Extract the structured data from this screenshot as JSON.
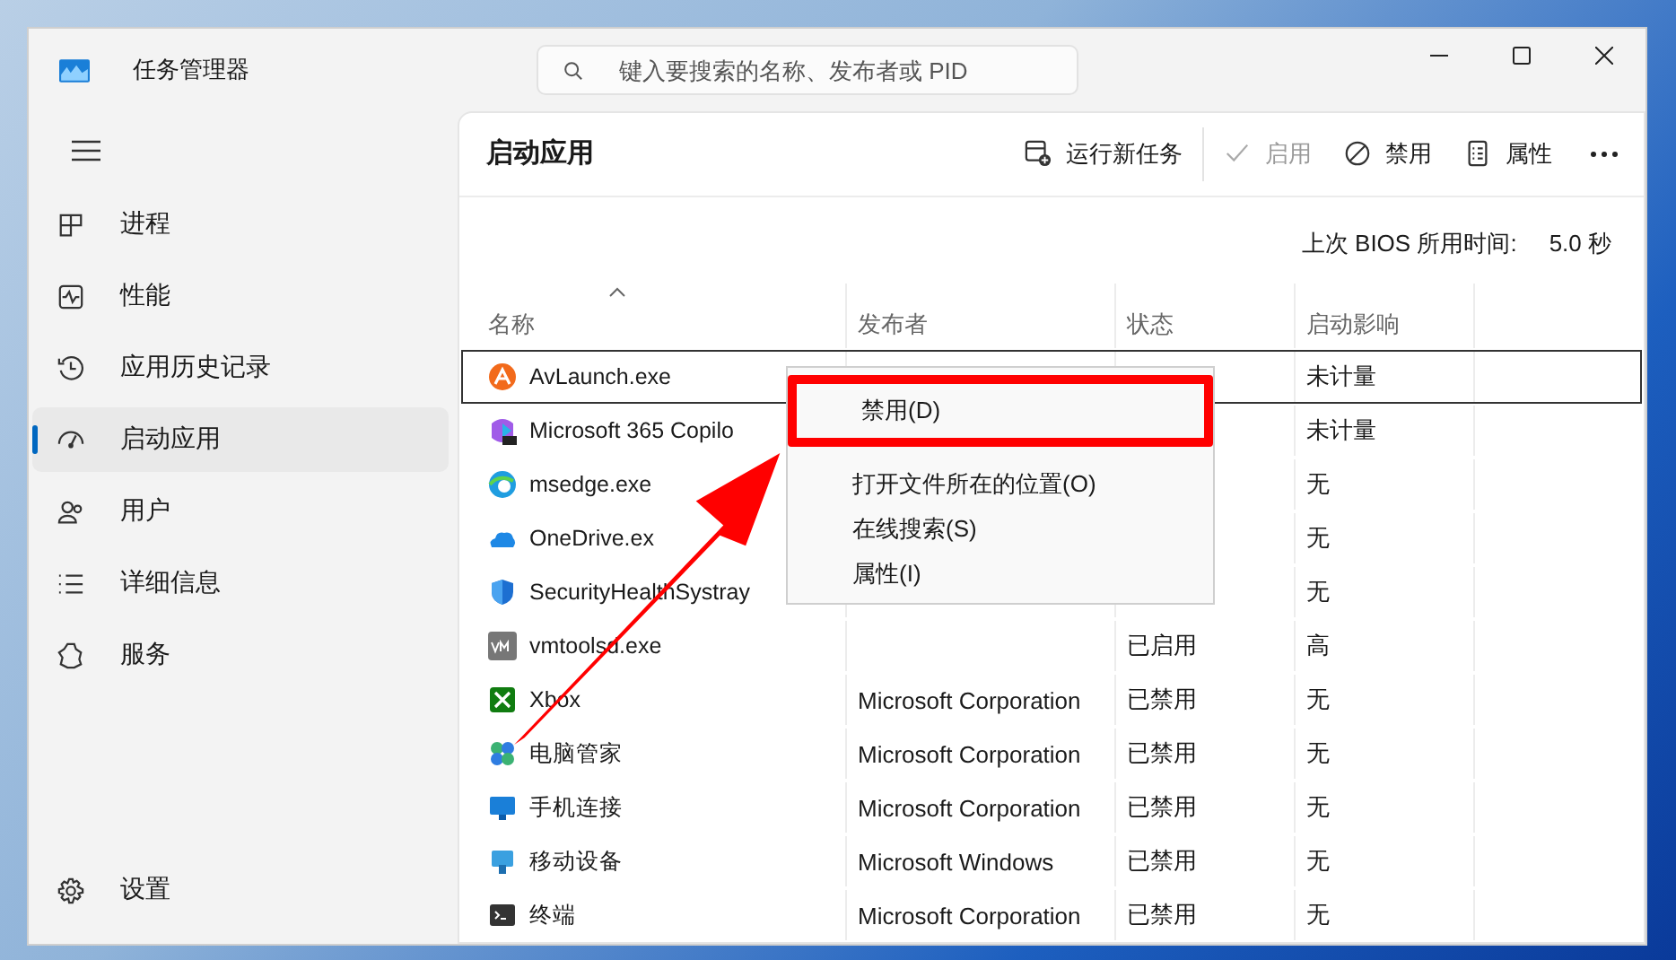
{
  "window": {
    "title": "任务管理器"
  },
  "search": {
    "placeholder": "键入要搜索的名称、发布者或 PID"
  },
  "sidebar": {
    "items": [
      {
        "label": "进程",
        "selected": false
      },
      {
        "label": "性能",
        "selected": false
      },
      {
        "label": "应用历史记录",
        "selected": false
      },
      {
        "label": "启动应用",
        "selected": true
      },
      {
        "label": "用户",
        "selected": false
      },
      {
        "label": "详细信息",
        "selected": false
      },
      {
        "label": "服务",
        "selected": false
      }
    ],
    "footer": {
      "label": "设置"
    }
  },
  "page": {
    "title": "启动应用",
    "toolbar": [
      {
        "label": "运行新任务",
        "disabled": false
      },
      {
        "label": "启用",
        "disabled": true
      },
      {
        "label": "禁用",
        "disabled": false
      },
      {
        "label": "属性",
        "disabled": false
      }
    ],
    "bios": {
      "label": "上次 BIOS 所用时间:",
      "value": "5.0 秒"
    }
  },
  "table": {
    "columns": [
      "名称",
      "发布者",
      "状态",
      "启动影响"
    ],
    "rows": [
      {
        "name": "AvLaunch.exe",
        "impact": "未计量",
        "selected": true
      },
      {
        "name": "Microsoft 365 Copilo",
        "impact": "未计量",
        "selected": false
      },
      {
        "name": "msedge.exe",
        "impact": "无",
        "selected": false
      },
      {
        "name": "OneDrive.ex",
        "impact": "无",
        "selected": false
      },
      {
        "name": "SecurityHealthSystray",
        "impact": "无",
        "selected": false
      },
      {
        "name": "vmtoolsd.exe",
        "status": "已启用",
        "impact": "高",
        "selected": false
      },
      {
        "name": "Xbox",
        "publisher": "Microsoft Corporation",
        "status": "已禁用",
        "impact": "无",
        "selected": false
      },
      {
        "name": "电脑管家",
        "publisher": "Microsoft Corporation",
        "status": "已禁用",
        "impact": "无",
        "selected": false
      },
      {
        "name": "手机连接",
        "publisher": "Microsoft Corporation",
        "status": "已禁用",
        "impact": "无",
        "selected": false
      },
      {
        "name": "移动设备",
        "publisher": "Microsoft Windows",
        "status": "已禁用",
        "impact": "无",
        "selected": false
      },
      {
        "name": "终端",
        "publisher": "Microsoft Corporation",
        "status": "已禁用",
        "impact": "无",
        "selected": false
      }
    ]
  },
  "context_menu": {
    "items": [
      {
        "label": "禁用(D)",
        "highlighted": true
      },
      {
        "label": "打开文件所在的位置(O)",
        "highlighted": false
      },
      {
        "label": "在线搜索(S)",
        "highlighted": false
      },
      {
        "label": "属性(I)",
        "highlighted": false
      }
    ]
  }
}
